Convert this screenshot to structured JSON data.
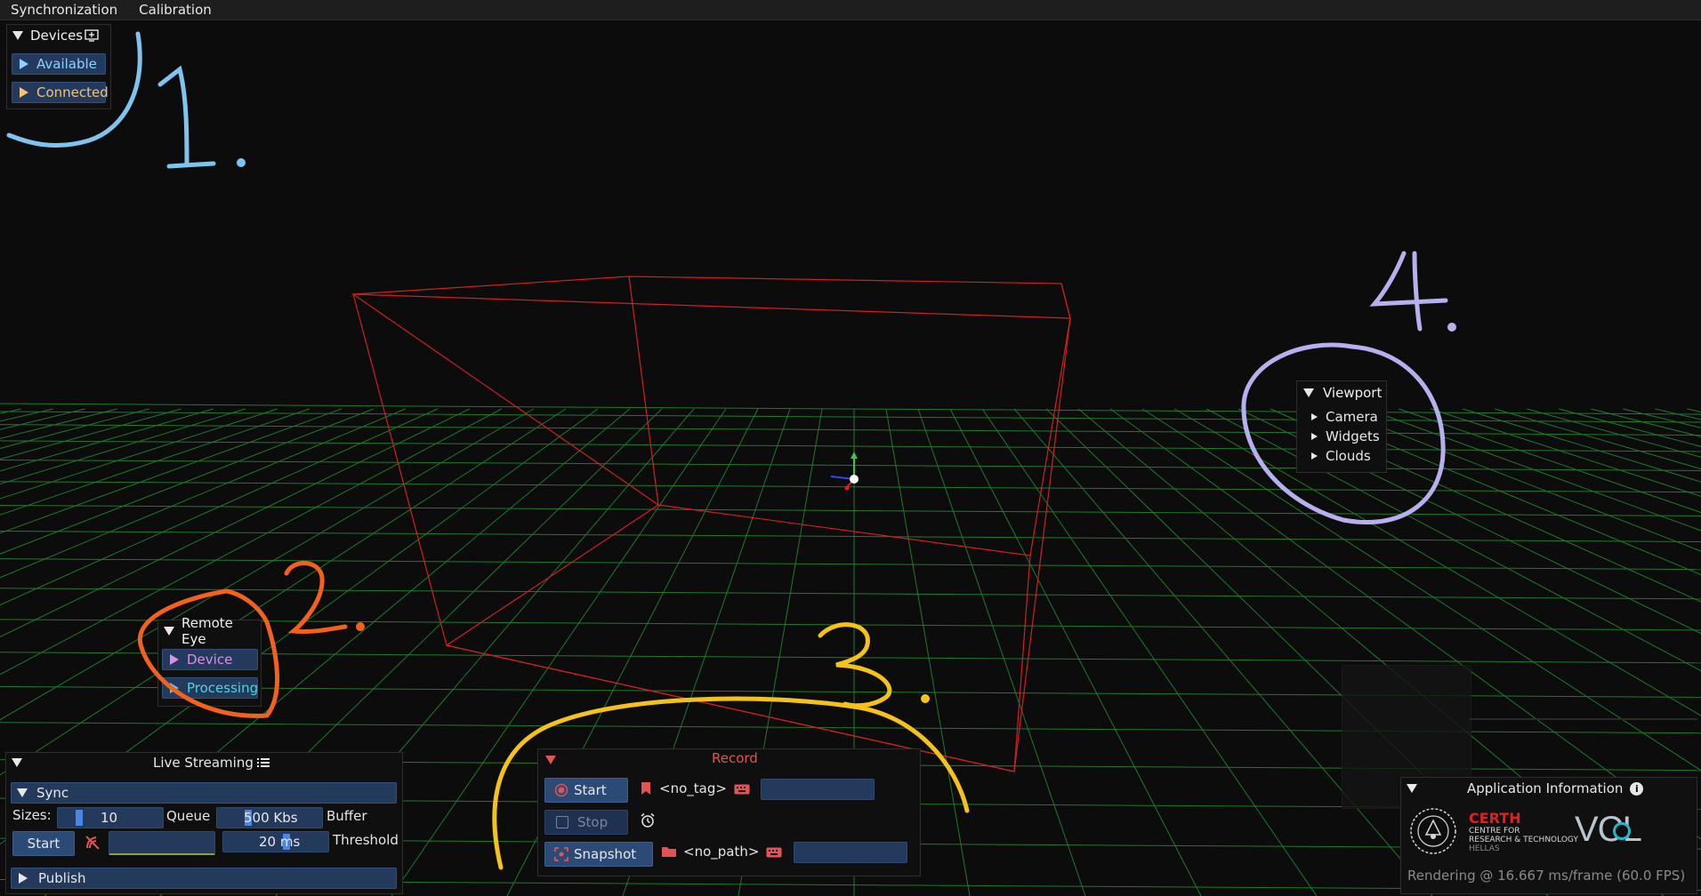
{
  "menu": {
    "items": [
      "Synchronization",
      "Calibration"
    ]
  },
  "devices": {
    "title": "Devices",
    "items": [
      {
        "label": "Available",
        "color": "#8fd0ff"
      },
      {
        "label": "Connected",
        "color": "#f5c078"
      }
    ]
  },
  "remote_eye": {
    "title": "Remote Eye",
    "items": [
      {
        "label": "Device",
        "color": "#d98ee8"
      },
      {
        "label": "Processing",
        "color": "#4fd4e0"
      }
    ]
  },
  "viewport": {
    "title": "Viewport",
    "items": [
      "Camera",
      "Widgets",
      "Clouds"
    ]
  },
  "live_streaming": {
    "title": "Live Streaming",
    "sync": {
      "label": "Sync"
    },
    "sizes_label": "Sizes:",
    "queue_value": "10",
    "queue_label": "Queue",
    "buffer_value": "500 Kbs",
    "buffer_label": "Buffer",
    "start_label": "Start",
    "threshold_value": "20 ms",
    "threshold_label": "Threshold",
    "publish": {
      "label": "Publish"
    }
  },
  "record": {
    "title": "Record",
    "start_label": "Start",
    "stop_label": "Stop",
    "snapshot_label": "Snapshot",
    "tag": "<no_tag>",
    "path": "<no_path>"
  },
  "app_info": {
    "title": "Application Information",
    "org_name": "CERTH",
    "org_line1": "CENTRE FOR",
    "org_line2": "RESEARCH & TECHNOLOGY",
    "org_line3": "HELLAS",
    "lab": "VCL",
    "rendering": "Rendering @ 16.667 ms/frame (60.0 FPS)"
  },
  "annotations": [
    "1.",
    "2.",
    "3.",
    "4."
  ],
  "colors": {
    "grid": "#1f7a2a",
    "box": "#d02020",
    "annot1": "#7ec4ef",
    "annot2": "#f2621e",
    "annot3": "#f5c21a",
    "annot4": "#b7b0ee",
    "record_red": "#e05454"
  }
}
